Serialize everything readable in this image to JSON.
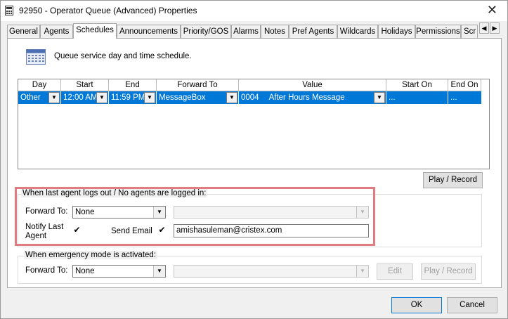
{
  "window": {
    "title": "92950 - Operator Queue (Advanced) Properties",
    "close_glyph": "✕"
  },
  "tabs": [
    "General",
    "Agents",
    "Schedules",
    "Announcements",
    "Priority/GOS",
    "Alarms",
    "Notes",
    "Pref Agents",
    "Wildcards",
    "Holidays",
    "Permissions",
    "Scr"
  ],
  "active_tab": "Schedules",
  "tab_scroll": {
    "left": "◀",
    "right": "▶"
  },
  "schedules": {
    "description": "Queue service day and time schedule.",
    "columns": [
      "Day",
      "Start",
      "End",
      "Forward To",
      "Value",
      "Start On",
      "End On"
    ],
    "rows": [
      {
        "day": "Other",
        "start": "12:00 AM",
        "end": "11:59 PM",
        "forward_to": "MessageBox",
        "value_code": "0004",
        "value_name": "After Hours Message",
        "start_on": "...",
        "end_on": "..."
      }
    ],
    "play_record_label": "Play / Record"
  },
  "last_agent_group": {
    "label": "When last agent logs out / No agents are logged in:",
    "forward_to_label": "Forward To:",
    "forward_to_value": "None",
    "notify_label_line1": "Notify Last",
    "notify_label_line2": "Agent",
    "notify_checked": true,
    "send_email_label": "Send Email",
    "send_email_checked": true,
    "email_value": "amishasuleman@cristex.com"
  },
  "emergency_group": {
    "label": "When emergency mode is activated:",
    "forward_to_label": "Forward To:",
    "forward_to_value": "None",
    "edit_label": "Edit",
    "play_record_label": "Play / Record"
  },
  "footer": {
    "ok_label": "OK",
    "cancel_label": "Cancel"
  },
  "check_glyph": "✔",
  "dropdown_glyph": "▼",
  "colors": {
    "selection": "#0078d7",
    "highlight_box": "#e07b82"
  }
}
